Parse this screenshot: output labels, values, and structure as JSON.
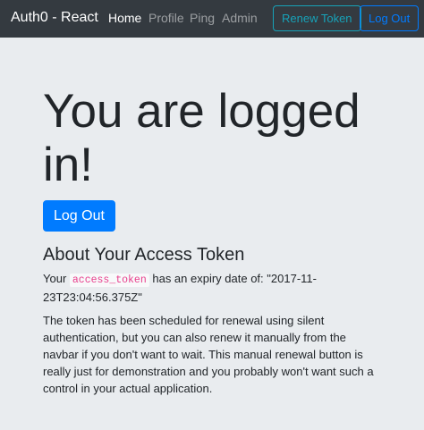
{
  "navbar": {
    "brand": "Auth0 - React",
    "links": [
      {
        "label": "Home",
        "active": true
      },
      {
        "label": "Profile",
        "active": false
      },
      {
        "label": "Ping",
        "active": false
      },
      {
        "label": "Admin",
        "active": false
      }
    ],
    "renew_label": "Renew Token",
    "logout_label": "Log Out"
  },
  "main": {
    "title": "You are logged in!",
    "logout_label": "Log Out",
    "about_heading": "About Your Access Token",
    "expiry": {
      "prefix": "Your",
      "code": "access_token",
      "middle": "has an expiry date of:",
      "value": "\"2017-11-23T23:04:56.375Z\""
    },
    "renewal_text": "The token has been scheduled for renewal using silent authentication, but you can also renew it manually from the navbar if you don't want to wait. This manual renewal button is really just for demonstration and you probably won't want such a control in your actual application."
  },
  "colors": {
    "navbar_bg": "#343a40",
    "page_bg": "#e9ecef",
    "primary": "#007bff",
    "info": "#17a2b8",
    "code": "#e83e8c"
  }
}
